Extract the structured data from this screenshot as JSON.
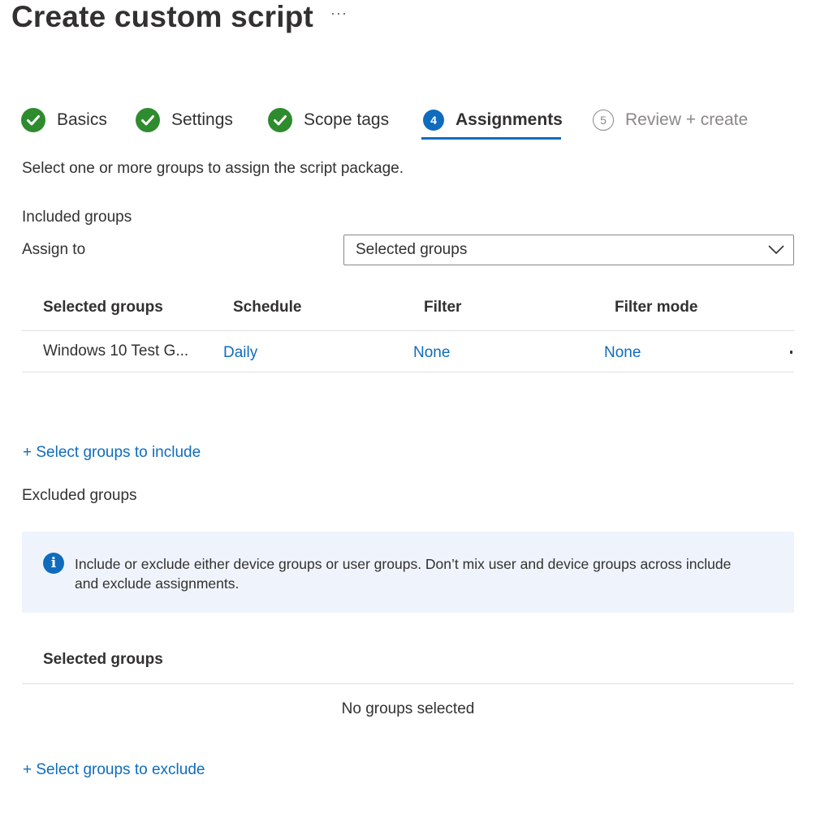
{
  "page": {
    "title": "Create custom script",
    "more_label": "···"
  },
  "wizard": {
    "steps": [
      {
        "label": "Basics",
        "status": "complete"
      },
      {
        "label": "Settings",
        "status": "complete"
      },
      {
        "label": "Scope tags",
        "status": "complete"
      },
      {
        "label": "Assignments",
        "status": "current",
        "number": "4"
      },
      {
        "label": "Review + create",
        "status": "pending",
        "number": "5"
      }
    ]
  },
  "assignments": {
    "intro": "Select one or more groups to assign the script package.",
    "included": {
      "heading": "Included groups",
      "assign_to_label": "Assign to",
      "assign_to_value": "Selected groups",
      "columns": [
        "Selected groups",
        "Schedule",
        "Filter",
        "Filter mode"
      ],
      "rows": [
        {
          "group": "Windows 10 Test G...",
          "schedule": "Daily",
          "filter": "None",
          "filter_mode": "None"
        }
      ],
      "add_link": "+ Select groups to include"
    },
    "excluded": {
      "heading": "Excluded groups",
      "info": "Include or exclude either device groups or user groups. Don’t mix user and device groups across include and exclude assignments.",
      "column": "Selected groups",
      "empty": "No groups selected",
      "add_link": "+ Select groups to exclude"
    }
  },
  "colors": {
    "accent": "#0f6cbd",
    "success": "#2e8b2e",
    "info_bg": "#eff4fc",
    "text": "#323130"
  }
}
